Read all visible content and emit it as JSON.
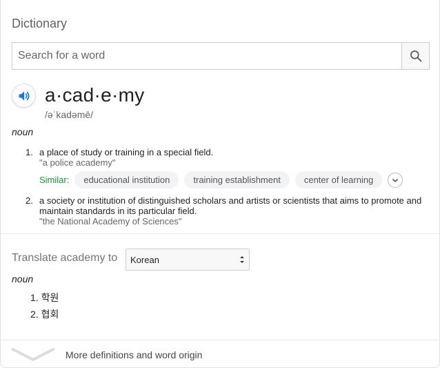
{
  "title": "Dictionary",
  "search": {
    "placeholder": "Search for a word",
    "value": ""
  },
  "entry": {
    "word": "a·cad·e·my",
    "phonetic": "/əˈkadəmē/",
    "part_of_speech": "noun",
    "definitions": [
      {
        "number": "1.",
        "text": "a place of study or training in a special field.",
        "example": "\"a police academy\""
      },
      {
        "number": "2.",
        "text": "a society or institution of distinguished scholars and artists or scientists that aims to promote and maintain standards in its particular field.",
        "example": "\"the National Academy of Sciences\""
      }
    ],
    "similar": {
      "label": "Similar:",
      "chips": [
        "educational institution",
        "training establishment",
        "center of learning"
      ]
    }
  },
  "translate": {
    "label": "Translate academy to",
    "language": "Korean",
    "part_of_speech": "noun",
    "items": [
      {
        "number": "1.",
        "text": "학원"
      },
      {
        "number": "2.",
        "text": "협회"
      }
    ]
  },
  "more": {
    "label": "More definitions and word origin"
  },
  "colors": {
    "accent_blue": "#1a73e8",
    "similar_green": "#1e8e3e",
    "chip_bg": "#f1f3f4"
  },
  "icons": {
    "search": "search-icon",
    "speaker": "speaker-icon",
    "expand": "chevron-down-icon",
    "more": "chevron-down-icon",
    "select": "select-arrows-icon"
  }
}
